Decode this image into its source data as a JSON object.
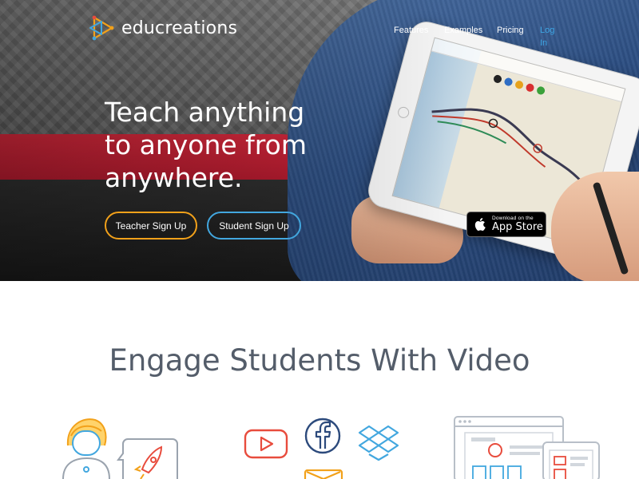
{
  "brand": {
    "name": "educreations",
    "colors": {
      "orange": "#f2a11a",
      "blue": "#42a7df",
      "red": "#e84c3d",
      "navy": "#2c4a7c",
      "text": "#545d6a"
    }
  },
  "nav": {
    "items": [
      {
        "label": "Features"
      },
      {
        "label": "Examples"
      },
      {
        "label": "Pricing"
      },
      {
        "label": "Log In"
      }
    ]
  },
  "hero": {
    "headline_lines": [
      "Teach anything",
      "to anyone from",
      "anywhere."
    ],
    "buttons": {
      "teacher": "Teacher Sign Up",
      "student": "Student Sign Up"
    },
    "app_store": {
      "small": "Download on the",
      "big": "App Store"
    }
  },
  "section": {
    "title": "Engage Students With Video"
  },
  "icons": {
    "logo": "educreations-logo-icon",
    "features": [
      "teacher-avatar-icon",
      "rocket-bubble-icon",
      "youtube-icon",
      "facebook-icon",
      "dropbox-icon",
      "email-icon",
      "browser-window-icon"
    ]
  }
}
